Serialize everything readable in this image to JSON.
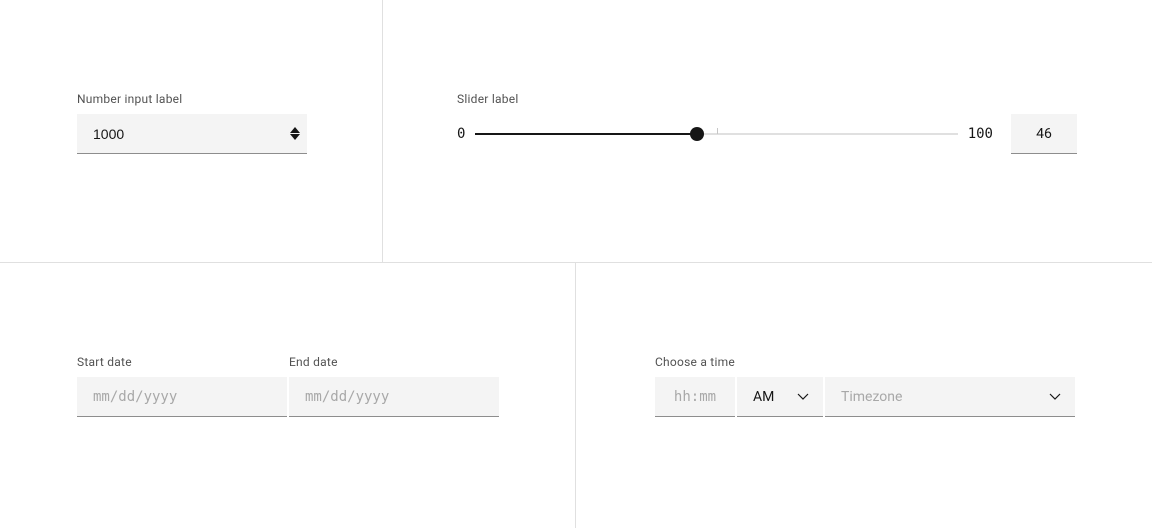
{
  "number_input": {
    "label": "Number input label",
    "value": "1000"
  },
  "slider": {
    "label": "Slider label",
    "min": "0",
    "max": "100",
    "value": "46",
    "value_pct": 46,
    "tick_pct": 50
  },
  "date_start": {
    "label": "Start date",
    "value": "",
    "placeholder": "mm/dd/yyyy"
  },
  "date_end": {
    "label": "End date",
    "value": "",
    "placeholder": "mm/dd/yyyy"
  },
  "time": {
    "label": "Choose a time",
    "value": "",
    "placeholder": "hh:mm",
    "ampm": "AM",
    "timezone_placeholder": "Timezone"
  }
}
